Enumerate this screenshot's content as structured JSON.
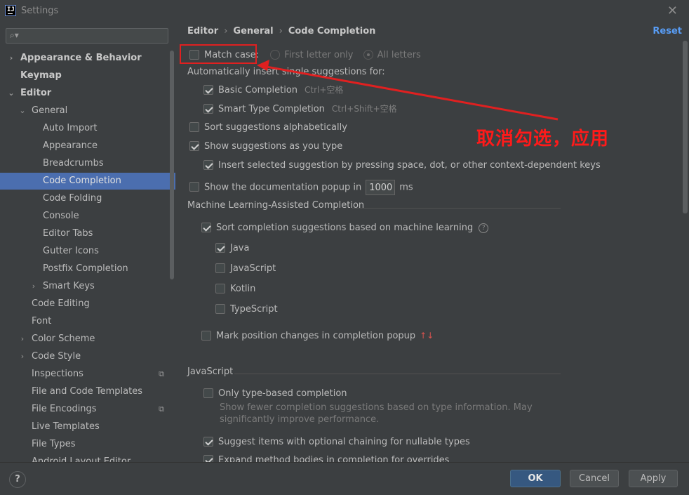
{
  "window": {
    "title": "Settings",
    "icon_label": "IJ"
  },
  "sidebar": {
    "search_placeholder": "",
    "items": [
      {
        "label": "Appearance & Behavior",
        "level": 0,
        "arrow": "›",
        "bold": true
      },
      {
        "label": "Keymap",
        "level": 0,
        "arrow": "",
        "bold": true
      },
      {
        "label": "Editor",
        "level": 0,
        "arrow": "⌄",
        "bold": true
      },
      {
        "label": "General",
        "level": 1,
        "arrow": "⌄"
      },
      {
        "label": "Auto Import",
        "level": 2,
        "arrow": ""
      },
      {
        "label": "Appearance",
        "level": 2,
        "arrow": ""
      },
      {
        "label": "Breadcrumbs",
        "level": 2,
        "arrow": ""
      },
      {
        "label": "Code Completion",
        "level": 2,
        "arrow": "",
        "selected": true
      },
      {
        "label": "Code Folding",
        "level": 2,
        "arrow": ""
      },
      {
        "label": "Console",
        "level": 2,
        "arrow": ""
      },
      {
        "label": "Editor Tabs",
        "level": 2,
        "arrow": ""
      },
      {
        "label": "Gutter Icons",
        "level": 2,
        "arrow": ""
      },
      {
        "label": "Postfix Completion",
        "level": 2,
        "arrow": ""
      },
      {
        "label": "Smart Keys",
        "level": 2,
        "arrow": "›"
      },
      {
        "label": "Code Editing",
        "level": 1,
        "arrow": ""
      },
      {
        "label": "Font",
        "level": 1,
        "arrow": ""
      },
      {
        "label": "Color Scheme",
        "level": 1,
        "arrow": "›"
      },
      {
        "label": "Code Style",
        "level": 1,
        "arrow": "›"
      },
      {
        "label": "Inspections",
        "level": 1,
        "arrow": "",
        "badge": "⧉"
      },
      {
        "label": "File and Code Templates",
        "level": 1,
        "arrow": ""
      },
      {
        "label": "File Encodings",
        "level": 1,
        "arrow": "",
        "badge": "⧉"
      },
      {
        "label": "Live Templates",
        "level": 1,
        "arrow": ""
      },
      {
        "label": "File Types",
        "level": 1,
        "arrow": ""
      },
      {
        "label": "Android Layout Editor",
        "level": 1,
        "arrow": ""
      }
    ]
  },
  "breadcrumb": [
    "Editor",
    "General",
    "Code Completion"
  ],
  "reset_label": "Reset",
  "settings": {
    "match_case": {
      "label": "Match case:",
      "checked": false
    },
    "first_letter": "First letter only",
    "all_letters": "All letters",
    "auto_insert_heading": "Automatically insert single suggestions for:",
    "basic": {
      "label": "Basic Completion",
      "shortcut": "Ctrl+空格",
      "checked": true
    },
    "smart": {
      "label": "Smart Type Completion",
      "shortcut": "Ctrl+Shift+空格",
      "checked": true
    },
    "sort_alpha": {
      "label": "Sort suggestions alphabetically",
      "checked": false
    },
    "show_as_type": {
      "label": "Show suggestions as you type",
      "checked": true
    },
    "insert_selected": {
      "label": "Insert selected suggestion by pressing space, dot, or other context-dependent keys",
      "checked": true
    },
    "doc_popup": {
      "label": "Show the documentation popup in",
      "value": "1000",
      "unit": "ms",
      "checked": false
    },
    "ml_heading": "Machine Learning-Assisted Completion",
    "ml_sort": {
      "label": "Sort completion suggestions based on machine learning",
      "checked": true,
      "help": "?"
    },
    "ml_langs": [
      {
        "label": "Java",
        "checked": true
      },
      {
        "label": "JavaScript",
        "checked": false
      },
      {
        "label": "Kotlin",
        "checked": false
      },
      {
        "label": "TypeScript",
        "checked": false
      }
    ],
    "mark_position": {
      "label": "Mark position changes in completion popup",
      "checked": false,
      "arrows": "↑↓"
    },
    "js_heading": "JavaScript",
    "type_based": {
      "label": "Only type-based completion",
      "checked": false
    },
    "type_based_desc_1": "Show fewer completion suggestions based on type information. May",
    "type_based_desc_2": "significantly improve performance.",
    "optional_chaining": {
      "label": "Suggest items with optional chaining for nullable types",
      "checked": true
    },
    "expand_method": {
      "label": "Expand method bodies in completion for overrides",
      "checked": true
    }
  },
  "annotation": {
    "text": "取消勾选，应用",
    "color": "#ff1a1a"
  },
  "footer": {
    "help": "?",
    "ok": "OK",
    "cancel": "Cancel",
    "apply": "Apply"
  },
  "colors": {
    "accent": "#4b6eaf",
    "link": "#589df6",
    "background": "#3c3f41",
    "primary_button": "#365880"
  }
}
